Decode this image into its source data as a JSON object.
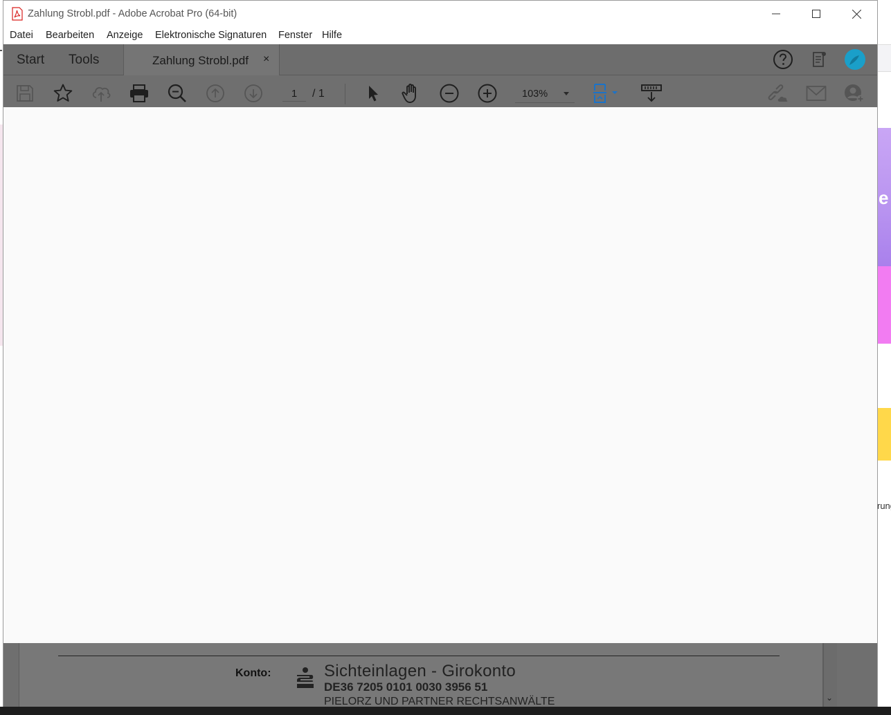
{
  "window": {
    "title": "Zahlung Strobl.pdf - Adobe Acrobat Pro (64-bit)"
  },
  "menu": {
    "items": [
      "Datei",
      "Bearbeiten",
      "Anzeige",
      "Elektronische Signaturen",
      "Fenster",
      "Hilfe"
    ]
  },
  "tabs": {
    "start": "Start",
    "tools": "Tools",
    "document": "Zahlung Strobl.pdf",
    "close": "×"
  },
  "toolbar": {
    "current_page": "1",
    "total_pages": "/ 1",
    "zoom": "103%"
  },
  "document": {
    "konto_label": "Konto:",
    "account_name": "Sichteinlagen - Girokonto",
    "iban": "DE36 7205 0101 0030 3956 51",
    "holder": "PIELORZ UND PARTNER RECHTSANWÄLTE"
  },
  "background": {
    "letter": "e",
    "text": "rung"
  },
  "colors": {
    "acrobat_red": "#d9201f",
    "avatar": "#1a9fc9",
    "toolbar_blue": "#1a73c9"
  }
}
